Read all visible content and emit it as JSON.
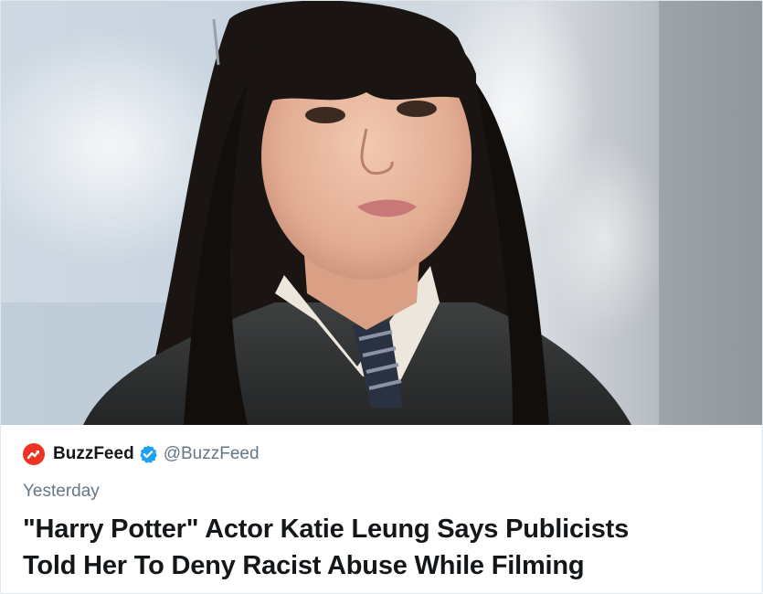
{
  "tweet": {
    "image": {
      "alt": ""
    },
    "author": {
      "name": "BuzzFeed",
      "handle": "@BuzzFeed",
      "verified": true,
      "logo_icon": "buzzfeed-trending-arrow-icon",
      "logo_color": "#ee3322"
    },
    "timestamp": "Yesterday",
    "headline": "\"Harry Potter\" Actor Katie Leung Says Publicists\nTold Her To Deny Racist Abuse While Filming"
  },
  "colors": {
    "text_primary": "#14171a",
    "text_secondary": "#657786",
    "verified_blue": "#1da1f2",
    "border": "#e1e8ed"
  }
}
